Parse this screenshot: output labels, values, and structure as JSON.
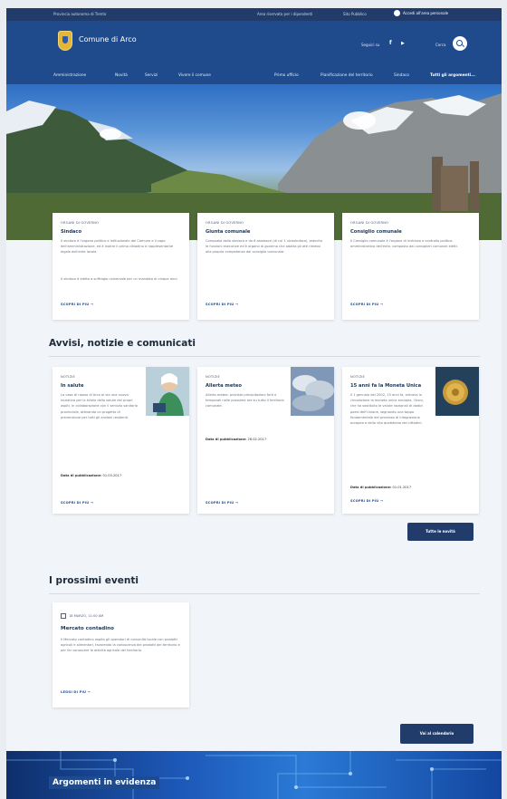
{
  "topbar": {
    "region": "Provincia autonoma di Trento",
    "admin_area": "Area riservata per i dipendenti",
    "city_link": "Sito Pubblico",
    "login": "Accedi all'area personale"
  },
  "header": {
    "site_name": "Comune di Arco",
    "follow": "Seguici su",
    "search_label": "Cerca"
  },
  "nav": {
    "items": [
      "Amministrazione",
      "Novità",
      "Servizi",
      "Vivere il comune"
    ],
    "right_items": [
      "Primo ufficio",
      "Pianificazione del territorio",
      "Sindaco"
    ],
    "all_topics": "Tutti gli argomenti..."
  },
  "featured_cards": [
    {
      "category": "Organi di governo",
      "title": "Sindaco",
      "text": "Il sindaco è l'organo politico e istituzionale del Comune e il capo dell'amministrazione, ed è inoltre il primo cittadino e rappresentante legale dell'ente locale.",
      "text2": "Il sindaco è eletto a suffragio universale per un mandato di cinque anni.",
      "more": "SCOPRI DI PIÙ  →"
    },
    {
      "category": "Organi di governo",
      "title": "Giunta comunale",
      "text": "Composta dalla sindaca e da 6 assessori (di cui 1 vicesindaco), esercita le funzioni esecutive ed è organo di governo che adotta gli atti rimessi alla propria competenza dal consiglio comunale.",
      "more": "SCOPRI DI PIÙ  →"
    },
    {
      "category": "Organi di governo",
      "title": "Consiglio comunale",
      "text": "Il Consiglio comunale è l'organo di indirizzo e controllo politico-amministrativo dell'ente, composto dai consiglieri comunali eletti.",
      "more": "SCOPRI DI PIÙ  →"
    }
  ],
  "news": {
    "section_title": "Avvisi, notizie e comunicati",
    "items": [
      {
        "category": "Notizie",
        "title": "In salute",
        "text": "La casa di riposo di Arco al via una nuova iniziativa per la tutela della salute dei propri ospiti, in collaborazione con il servizio sanitario provinciale, attivando un progetto di prevenzione per tutti gli anziani residenti.",
        "pub_label": "Data di pubblicazione:",
        "pub_date": "01.03.2017",
        "more": "SCOPRI DI PIÙ  →"
      },
      {
        "category": "Notizie",
        "title": "Allerta meteo",
        "text": "Allerta meteo: previste precipitazioni forti e temporali nelle prossime ore su tutto il territorio comunale.",
        "pub_label": "Data di pubblicazione:",
        "pub_date": "28.02.2017",
        "more": "SCOPRI DI PIÙ  →"
      },
      {
        "category": "Notizie",
        "title": "15 anni fa la Moneta Unica",
        "text": "Il 1 gennaio del 2002, 15 anni fa, entrava in circolazione la moneta unica europea, l'euro, che ha sostituito le valute nazionali di dodici paesi dell'Unione, segnando una tappa fondamentale del processo di integrazione europea e della vita quotidiana dei cittadini.",
        "pub_label": "Data di pubblicazione:",
        "pub_date": "01.01.2017",
        "more": "SCOPRI DI PIÙ  →"
      }
    ],
    "all_button": "Tutte le novità"
  },
  "events": {
    "section_title": "I prossimi eventi",
    "card": {
      "date": "18 MARZO, 11:00 AM",
      "title": "Mercato contadino",
      "text": "Il Mercato contadino ospita gli operatori di comunità locale con prodotti agricoli e alimentari, favorendo la conoscenza dei prodotti del territorio e per far conoscere le attività agricole del territorio.",
      "more": "LEGGI DI PIÙ  →"
    },
    "calendar_button": "Vai al calendario"
  },
  "topics": {
    "title": "Argomenti in evidenza"
  },
  "colors": {
    "header": "#1f4b8d",
    "topbar": "#213c6b",
    "accent": "#1f4b8d"
  }
}
